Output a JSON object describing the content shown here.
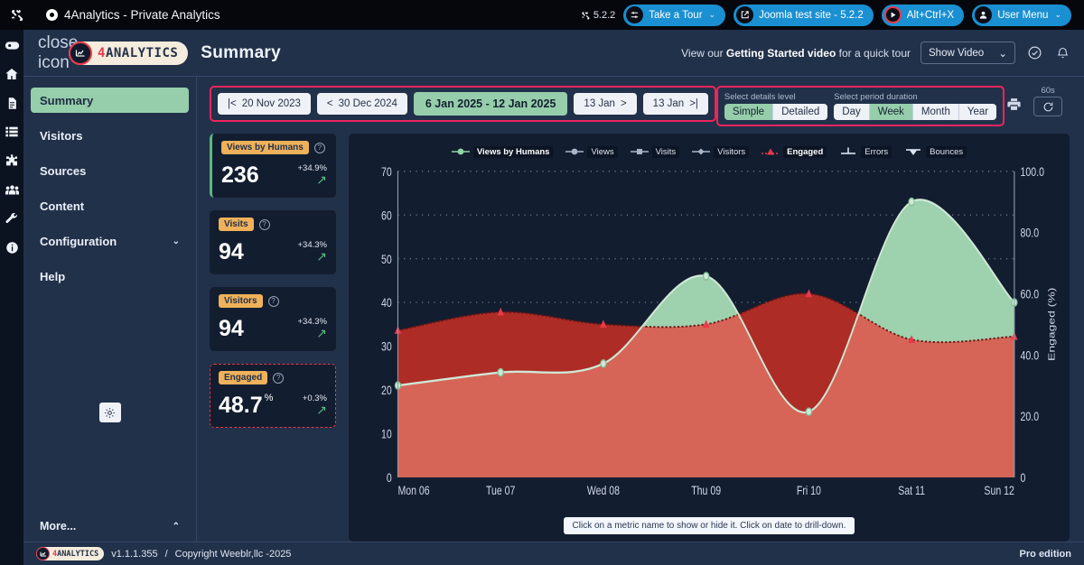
{
  "joomla_bar": {
    "logo_icon": "joomla-logo-icon",
    "site_dot_icon": "circle-dot-icon",
    "title": "4Analytics - Private Analytics",
    "version_icon": "joomla-mark-icon",
    "version": "5.2.2",
    "buttons": [
      {
        "name": "take-a-tour-button",
        "icon": "tour-icon",
        "label": "Take a Tour",
        "chevron": "⌄"
      },
      {
        "name": "site-preview-button",
        "icon": "external-link-icon",
        "label": "Joomla test site - 5.2.2",
        "chevron": ""
      },
      {
        "name": "shortcut-button",
        "icon": "play-circle-icon",
        "label": "Alt+Ctrl+X",
        "chevron": ""
      },
      {
        "name": "user-menu-button",
        "icon": "user-avatar-icon",
        "label": "User Menu",
        "chevron": "⌄"
      }
    ]
  },
  "rail": {
    "items": [
      {
        "name": "rail-toggle-icon",
        "icon": "toggle-icon"
      },
      {
        "name": "rail-home-icon",
        "icon": "home-icon"
      },
      {
        "name": "rail-content-icon",
        "icon": "document-icon"
      },
      {
        "name": "rail-menus-icon",
        "icon": "list-icon"
      },
      {
        "name": "rail-components-icon",
        "icon": "puzzle-icon"
      },
      {
        "name": "rail-users-icon",
        "icon": "users-icon"
      },
      {
        "name": "rail-system-icon",
        "icon": "wrench-icon"
      },
      {
        "name": "rail-help-icon",
        "icon": "info-icon"
      }
    ]
  },
  "header": {
    "close_icon": "close-icon",
    "brand_mark_icon": "chart-mark-icon",
    "brand_four": "4",
    "brand_rest": "ANALYTICS",
    "page_title": "Summary",
    "promo_prefix": "View our ",
    "promo_strong": "Getting Started video",
    "promo_suffix": " for a quick tour",
    "show_video_label": "Show Video",
    "show_video_chevron": "⌄",
    "check_icon": "check-circle-icon",
    "bell_icon": "bell-icon"
  },
  "sidebar": {
    "items": [
      {
        "label": "Summary",
        "active": true
      },
      {
        "label": "Visitors",
        "active": false
      },
      {
        "label": "Sources",
        "active": false
      },
      {
        "label": "Content",
        "active": false
      },
      {
        "label": "Configuration",
        "active": false,
        "chevron": "⌄"
      },
      {
        "label": "Help",
        "active": false
      }
    ],
    "theme_icon": "brightness-icon",
    "more_label": "More...",
    "more_chevron": "⌃"
  },
  "toolbar": {
    "date_buttons": [
      {
        "name": "first-period-button",
        "icon": "|<",
        "label": "20 Nov 2023",
        "current": false
      },
      {
        "name": "previous-period-button",
        "icon": "<",
        "label": "30 Dec 2024",
        "current": false
      },
      {
        "name": "current-period-button",
        "icon": "",
        "label": "6 Jan 2025 - 12 Jan 2025",
        "current": true
      },
      {
        "name": "next-period-button",
        "icon": ">",
        "label": "13 Jan",
        "current": false,
        "icon_after": true
      },
      {
        "name": "last-period-button",
        "icon": ">|",
        "label": "13 Jan",
        "current": false,
        "icon_after": true
      }
    ],
    "details_level": {
      "label": "Select details level",
      "options": [
        "Simple",
        "Detailed"
      ],
      "selected": "Simple"
    },
    "period_duration": {
      "label": "Select period duration",
      "options": [
        "Day",
        "Week",
        "Month",
        "Year"
      ],
      "selected": "Week"
    },
    "print_icon": "printer-icon",
    "refresh_seconds": "60s",
    "refresh_icon": "refresh-icon"
  },
  "cards": [
    {
      "tag": "Views by Humans",
      "help_icon": "help-icon",
      "value": "236",
      "unit": "",
      "delta": "+34.9%",
      "arrow": "↗",
      "state": "sel-green"
    },
    {
      "tag": "Visits",
      "help_icon": "help-icon",
      "value": "94",
      "unit": "",
      "delta": "+34.3%",
      "arrow": "↗",
      "state": ""
    },
    {
      "tag": "Visitors",
      "help_icon": "help-icon",
      "value": "94",
      "unit": "",
      "delta": "+34.3%",
      "arrow": "↗",
      "state": ""
    },
    {
      "tag": "Engaged",
      "help_icon": "help-icon",
      "value": "48.7",
      "unit": "%",
      "delta": "+0.3%",
      "arrow": "↗",
      "state": "sel-red"
    }
  ],
  "chart_hint": "Click on a metric name to show or hide it. Click on date to drill-down.",
  "chart_data": {
    "type": "area",
    "title": "",
    "categories": [
      "Mon 06",
      "Tue 07",
      "Wed 08",
      "Thu 09",
      "Fri 10",
      "Sat 11",
      "Sun 12"
    ],
    "series": [
      {
        "name": "Views by Humans",
        "axis": "left",
        "color": "#96ceab",
        "active": true,
        "values": [
          21,
          24,
          26,
          46,
          15,
          63,
          40
        ]
      },
      {
        "name": "Engaged",
        "axis": "right",
        "color": "#c0392b",
        "active": true,
        "values": [
          48,
          54,
          50,
          50,
          60,
          45,
          46
        ]
      }
    ],
    "hidden_series": [
      "Views",
      "Visits",
      "Visitors",
      "Errors",
      "Bounces"
    ],
    "legend": [
      {
        "label": "Views by Humans",
        "color": "#8fd6a6",
        "marker": "circle",
        "active": true
      },
      {
        "label": "Views",
        "color": "#aab6c7",
        "marker": "circle",
        "active": false
      },
      {
        "label": "Visits",
        "color": "#aab6c7",
        "marker": "square",
        "active": false
      },
      {
        "label": "Visitors",
        "color": "#aab6c7",
        "marker": "diamond",
        "active": false
      },
      {
        "label": "Engaged",
        "color": "#e8394a",
        "marker": "triangle",
        "active": true
      },
      {
        "label": "Errors",
        "color": "#dde5f0",
        "marker": "cross",
        "active": false
      },
      {
        "label": "Bounces",
        "color": "#dde5f0",
        "marker": "tee",
        "active": false
      }
    ],
    "legend_position": "top",
    "ylabel_left": "",
    "ylim_left": [
      0,
      70
    ],
    "yticks_left": [
      0,
      10,
      20,
      30,
      40,
      50,
      60,
      70
    ],
    "ylabel_right": "Engaged (%)",
    "ylim_right": [
      0,
      100
    ],
    "yticks_right": [
      "0",
      "20.0",
      "40.0",
      "60.0",
      "80.0",
      "100.0"
    ],
    "grid": true
  },
  "footer": {
    "brand_four": "4",
    "brand_rest": "ANALYTICS",
    "version": "v1.1.1.355",
    "separator": "/",
    "copyright": "Copyright Weeblr,llc -2025",
    "edition": "Pro edition"
  }
}
